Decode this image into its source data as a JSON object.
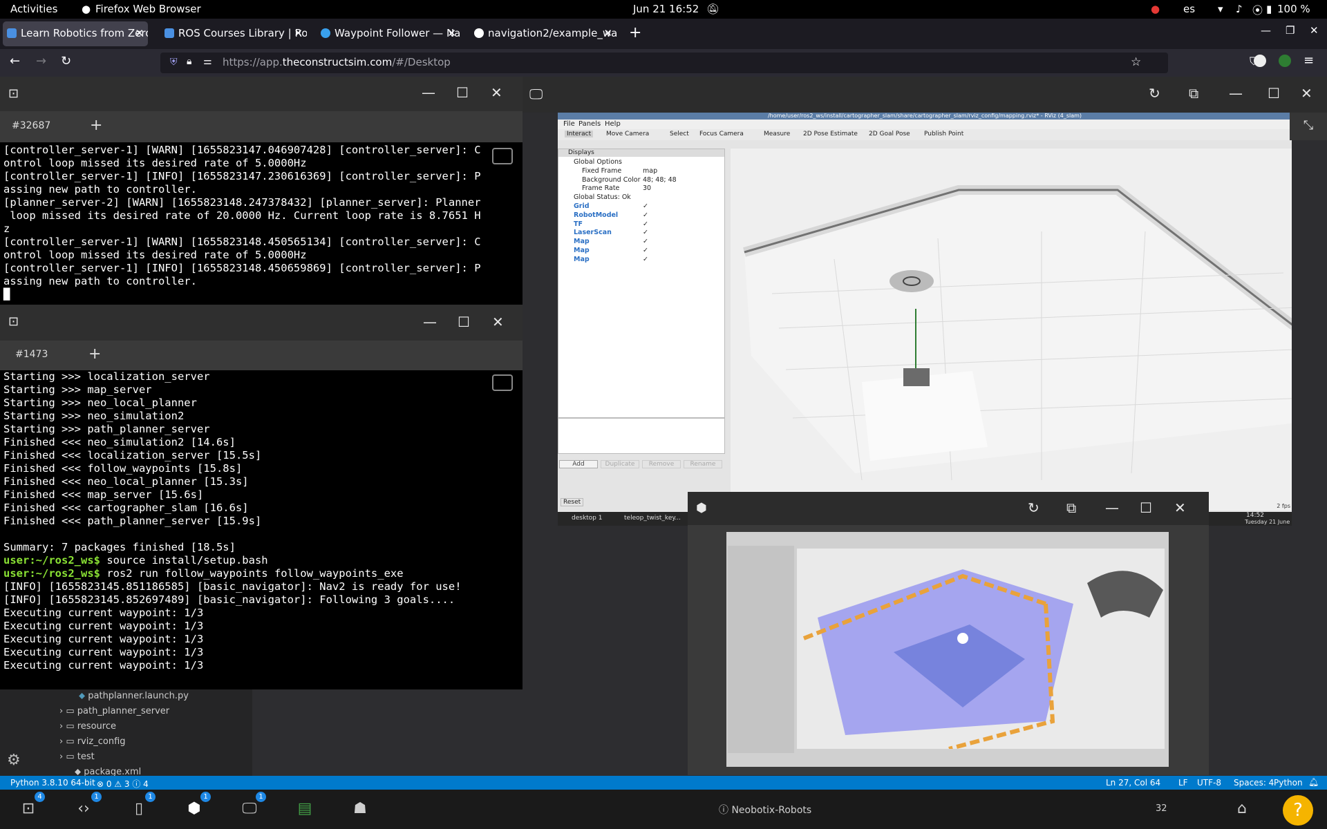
{
  "topbar": {
    "activities": "Activities",
    "app": "Firefox Web Browser",
    "clock": "Jun 21  16:52",
    "lang": "es",
    "battery": "100 %"
  },
  "tabs": [
    {
      "label": "Learn Robotics from Zero",
      "icon_color": "#4a90e2"
    },
    {
      "label": "ROS Courses Library | Rob",
      "icon_color": "#4a90e2"
    },
    {
      "label": "Waypoint Follower — Na",
      "icon_color": "#39a0ed"
    },
    {
      "label": "navigation2/example_wa",
      "icon_color": "#ffffff"
    }
  ],
  "url": {
    "prefix": "https://app.",
    "domain": "theconstructsim.com",
    "suffix": "/#/Desktop"
  },
  "term1": {
    "tab": "#32687",
    "lines": [
      "[controller_server-1] [WARN] [1655823147.046907428] [controller_server]: C",
      "ontrol loop missed its desired rate of 5.0000Hz",
      "[controller_server-1] [INFO] [1655823147.230616369] [controller_server]: P",
      "assing new path to controller.",
      "[planner_server-2] [WARN] [1655823148.247378432] [planner_server]: Planner",
      " loop missed its desired rate of 20.0000 Hz. Current loop rate is 8.7651 H",
      "z",
      "[controller_server-1] [WARN] [1655823148.450565134] [controller_server]: C",
      "ontrol loop missed its desired rate of 5.0000Hz",
      "[controller_server-1] [INFO] [1655823148.450659869] [controller_server]: P",
      "assing new path to controller."
    ]
  },
  "term2": {
    "tab": "#1473",
    "lines": [
      "Starting >>> localization_server",
      "Starting >>> map_server",
      "Starting >>> neo_local_planner",
      "Starting >>> neo_simulation2",
      "Starting >>> path_planner_server",
      "Finished <<< neo_simulation2 [14.6s]",
      "Finished <<< localization_server [15.5s]",
      "Finished <<< follow_waypoints [15.8s]",
      "Finished <<< neo_local_planner [15.3s]",
      "Finished <<< map_server [15.6s]",
      "Finished <<< cartographer_slam [16.6s]",
      "Finished <<< path_planner_server [15.9s]",
      "",
      "Summary: 7 packages finished [18.5s]"
    ],
    "prompt": "user:~/ros2_ws$",
    "cmd1": " source install/setup.bash",
    "cmd2": " ros2 run follow_waypoints follow_waypoints_exe",
    "out": [
      "[INFO] [1655823145.851186585] [basic_navigator]: Nav2 is ready for use!",
      "[INFO] [1655823145.852697489] [basic_navigator]: Following 3 goals....",
      "Executing current waypoint: 1/3",
      "Executing current waypoint: 1/3",
      "Executing current waypoint: 1/3",
      "Executing current waypoint: 1/3",
      "Executing current waypoint: 1/3"
    ]
  },
  "rviz": {
    "title": "/home/user/ros2_ws/install/cartographer_slam/share/cartographer_slam/rviz_config/mapping.rviz* - RViz (4_slam)",
    "menu": [
      "File",
      "Panels",
      "Help"
    ],
    "tools": [
      "Interact",
      "Move Camera",
      "Select",
      "Focus Camera",
      "Measure",
      "2D Pose Estimate",
      "2D Goal Pose",
      "Publish Point"
    ],
    "displays_title": "Displays",
    "displays": [
      {
        "label": "Global Options",
        "value": ""
      },
      {
        "label": "Fixed Frame",
        "value": "map"
      },
      {
        "label": "Background Color",
        "value": "48; 48; 48"
      },
      {
        "label": "Frame Rate",
        "value": "30"
      },
      {
        "label": "Global Status: Ok",
        "value": ""
      },
      {
        "label": "Grid",
        "value": "✓"
      },
      {
        "label": "RobotModel",
        "value": "✓"
      },
      {
        "label": "TF",
        "value": "✓"
      },
      {
        "label": "LaserScan",
        "value": "✓"
      },
      {
        "label": "Map",
        "value": "✓"
      },
      {
        "label": "Map",
        "value": "✓"
      },
      {
        "label": "Map",
        "value": "✓"
      }
    ],
    "buttons": [
      "Add",
      "Duplicate",
      "Remove",
      "Rename"
    ],
    "reset": "Reset",
    "fps": "2 fps",
    "desktop": "desktop 1",
    "teleop": "teleop_twist_key...",
    "clock_time": "14:52",
    "clock_date": "Tuesday 21 June"
  },
  "editor": {
    "files": [
      {
        "label": "pathplanner.launch.py",
        "type": "file"
      },
      {
        "label": "path_planner_server",
        "type": "folder"
      },
      {
        "label": "resource",
        "type": "folder"
      },
      {
        "label": "rviz_config",
        "type": "folder"
      },
      {
        "label": "test",
        "type": "folder"
      },
      {
        "label": "package.xml",
        "type": "file"
      }
    ]
  },
  "statusbar": {
    "python": "Python 3.8.10 64-bit",
    "problems": "⊗ 0 ⚠ 3 ⓘ 4",
    "position": "Ln 27, Col 64",
    "eol": "LF",
    "encoding": "UTF-8",
    "spaces": "Spaces: 4",
    "lang": "Python"
  },
  "taskbar": {
    "badges": [
      "4",
      "1",
      "1",
      "1",
      "1"
    ],
    "robot": "Neobotix-Robots",
    "count": "32",
    "help": "?"
  }
}
